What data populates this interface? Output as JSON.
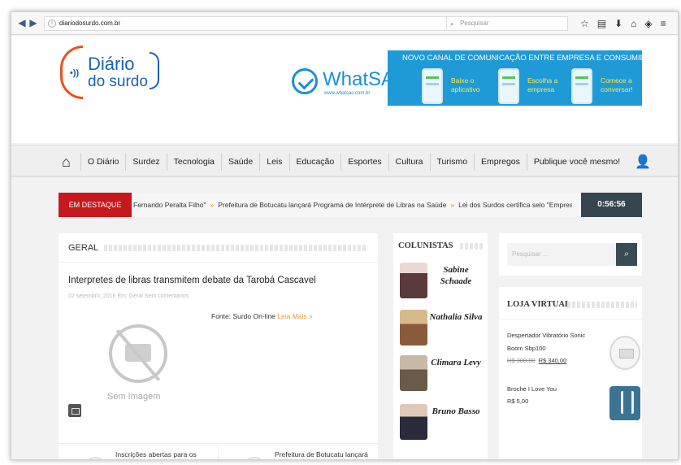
{
  "browser": {
    "url": "diariodosurdo.com.br",
    "search_placeholder": "Pesquisar"
  },
  "logo": {
    "line1": "Diário",
    "line2": "do surdo"
  },
  "banner": {
    "brand": "WhatSAC",
    "brand_url": "www.whatsac.com.br",
    "headline": "NOVO CANAL DE COMUNICAÇÃO ENTRE EMPRESA E CONSUMIDOR!",
    "steps": [
      "Baixe o aplicativo",
      "Escolha a empresa",
      "Comece a conversar!"
    ]
  },
  "menu": {
    "items": [
      "O Diário",
      "Surdez",
      "Tecnologia",
      "Saúde",
      "Leis",
      "Educação",
      "Esportes",
      "Cultura",
      "Turismo",
      "Empregos",
      "Publique você mesmo!"
    ]
  },
  "ticker": {
    "tag": "EM DESTAQUE",
    "items": [
      "Fernando Peralta Filho\"",
      "Prefeitura de Botucatu lançará Programa de Intérprete de Libras na Saúde",
      "Lei dos Surdos certifica selo \"Empresa Am"
    ],
    "time": "0:56:56"
  },
  "main": {
    "section_label": "GERAL",
    "post_title": "Interpretes de libras transmitem debate da Tarobá Cascavel",
    "post_meta": "02 setembro, 2016  Em: Geral  Sem comentários",
    "source_text": "Fonte: Surdo On-line",
    "read_more": "Leia Mais »",
    "no_image_label": "Sem Imagem",
    "related": [
      "Inscrições abertas para os",
      "Prefeitura de Botucatu lançará"
    ]
  },
  "columnists": {
    "label": "COLUNISTAS",
    "items": [
      {
        "name": "Sabine Schaade",
        "photo_color": "#5a3a3a"
      },
      {
        "name": "Nathalia Silva",
        "photo_color": "#c79a5a"
      },
      {
        "name": "Climara Levy",
        "photo_color": "#7a6a5a"
      },
      {
        "name": "Bruno Basso",
        "photo_color": "#3a2a2a"
      }
    ]
  },
  "sidebar": {
    "search_placeholder": "Pesquisar ...",
    "shop_label": "LOJA VIRTUAL",
    "products": [
      {
        "name": "Despertador Vibratório Sonic Boom Sbp100",
        "old_price": "R$ 380,00",
        "price": "R$ 340,00"
      },
      {
        "name": "Broche I Love You",
        "old_price": "",
        "price": "R$ 5,00"
      }
    ]
  },
  "colors": {
    "accent_red": "#c7191d",
    "brand_blue": "#1a63b1",
    "banner_blue": "#1f9ad6",
    "time_bg": "#36464e"
  }
}
